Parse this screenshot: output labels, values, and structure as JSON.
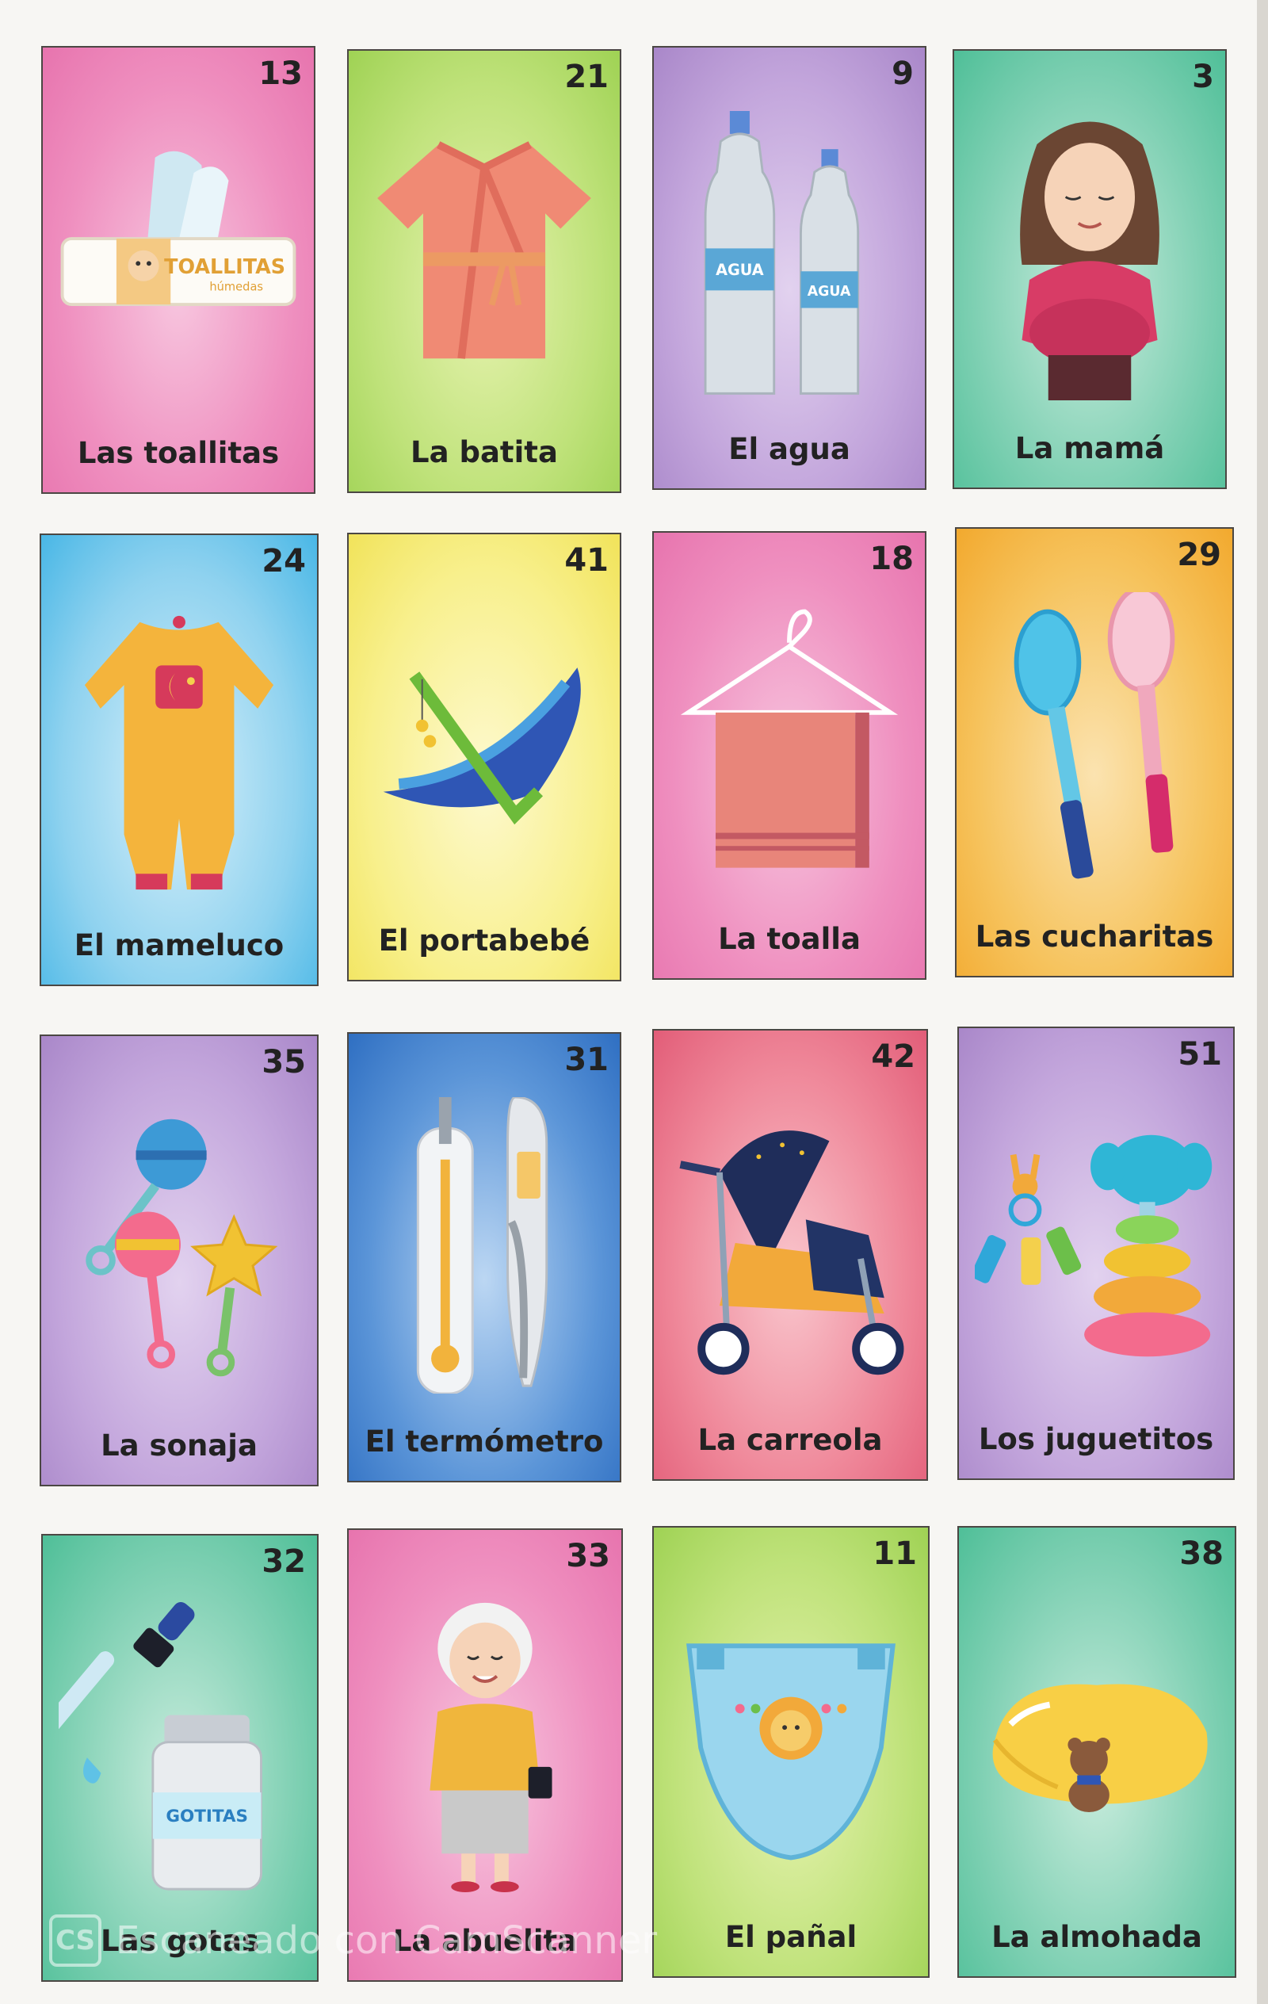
{
  "board": {
    "cards": [
      {
        "number": "13",
        "label": "Las toallitas",
        "art": "wet-wipes-icon",
        "bg": "pink",
        "art_text": [
          "TOALLITAS",
          "húmedas"
        ]
      },
      {
        "number": "21",
        "label": "La batita",
        "art": "robe-icon",
        "bg": "green"
      },
      {
        "number": "9",
        "label": "El agua",
        "art": "water-bottles-icon",
        "bg": "purple",
        "art_text": [
          "AGUA",
          "AGUA"
        ]
      },
      {
        "number": "3",
        "label": "La mamá",
        "art": "pregnant-mother-icon",
        "bg": "teal"
      },
      {
        "number": "24",
        "label": "El mameluco",
        "art": "onesie-icon",
        "bg": "blue"
      },
      {
        "number": "41",
        "label": "El portabebé",
        "art": "baby-bouncer-icon",
        "bg": "yellow"
      },
      {
        "number": "18",
        "label": "La toalla",
        "art": "towel-hanger-icon",
        "bg": "pink"
      },
      {
        "number": "29",
        "label": "Las cucharitas",
        "art": "spoons-icon",
        "bg": "orange"
      },
      {
        "number": "35",
        "label": "La sonaja",
        "art": "rattles-icon",
        "bg": "purple"
      },
      {
        "number": "31",
        "label": "El termómetro",
        "art": "thermometers-icon",
        "bg": "dblue"
      },
      {
        "number": "42",
        "label": "La carreola",
        "art": "stroller-icon",
        "bg": "coral"
      },
      {
        "number": "51",
        "label": "Los juguetitos",
        "art": "toys-icon",
        "bg": "purple"
      },
      {
        "number": "32",
        "label": "Las gotas",
        "art": "dropper-bottle-icon",
        "bg": "teal",
        "art_text": [
          "GOTITAS"
        ]
      },
      {
        "number": "33",
        "label": "La abuelita",
        "art": "grandmother-icon",
        "bg": "pink"
      },
      {
        "number": "11",
        "label": "El pañal",
        "art": "diaper-icon",
        "bg": "green"
      },
      {
        "number": "38",
        "label": "La almohada",
        "art": "pillow-teddy-icon",
        "bg": "teal"
      }
    ]
  },
  "watermark": {
    "logo": "CS",
    "text": "Escaneado con CamScanner"
  }
}
